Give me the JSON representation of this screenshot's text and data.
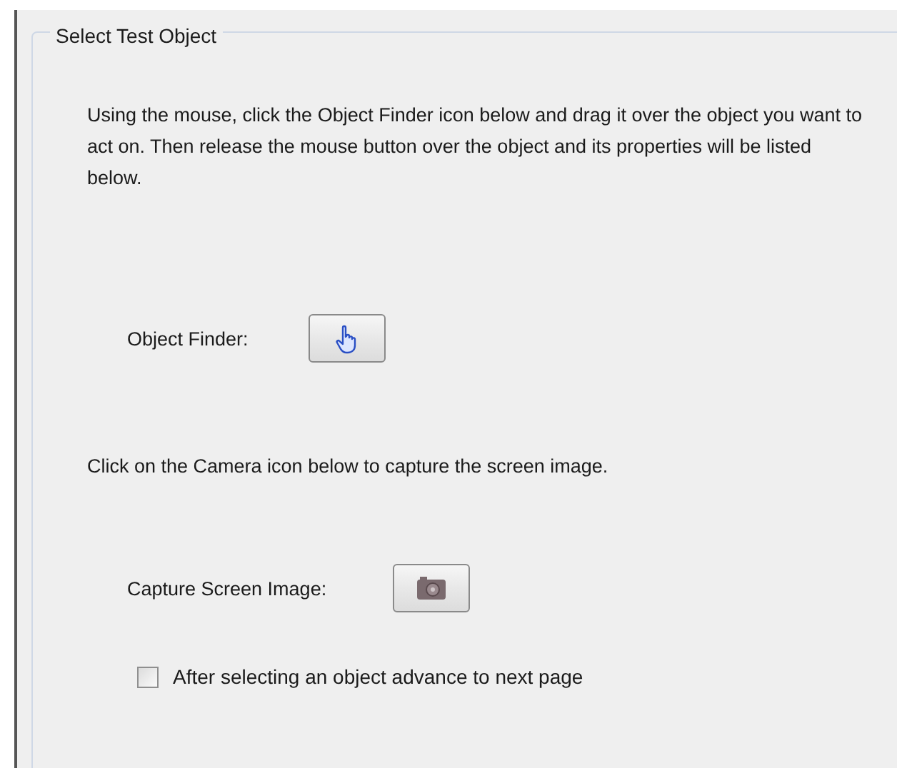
{
  "group": {
    "title": "Select Test Object"
  },
  "instructions": "Using the mouse, click the Object Finder icon below and drag it over the object you want to act on. Then release the mouse button over the object and its properties will be listed below.",
  "object_finder": {
    "label": "Object Finder:"
  },
  "camera_instructions": "Click on the Camera icon below to capture the screen image.",
  "capture": {
    "label": "Capture Screen Image:"
  },
  "advance_checkbox": {
    "label": "After selecting an object advance to next page",
    "checked": false
  }
}
